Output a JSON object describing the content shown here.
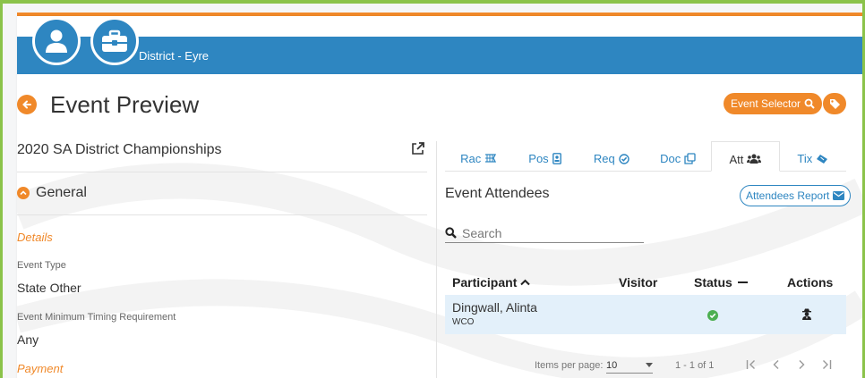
{
  "header": {
    "district": "District - Eyre"
  },
  "page": {
    "title": "Event Preview"
  },
  "actions": {
    "event_selector": "Event Selector"
  },
  "event": {
    "name": "2020 SA District Championships",
    "section": "General",
    "details_heading": "Details",
    "fields": [
      {
        "label": "Event Type",
        "value": "State Other"
      },
      {
        "label": "Event Minimum Timing Requirement",
        "value": "Any"
      }
    ],
    "payment_heading": "Payment"
  },
  "tabs": [
    {
      "label": "Rac",
      "icon": "checkered-flag-icon"
    },
    {
      "label": "Pos",
      "icon": "id-badge-icon"
    },
    {
      "label": "Req",
      "icon": "check-circle-icon"
    },
    {
      "label": "Doc",
      "icon": "copy-docs-icon"
    },
    {
      "label": "Att",
      "icon": "users-icon",
      "active": true
    },
    {
      "label": "Tix",
      "icon": "ticket-icon"
    }
  ],
  "attendees": {
    "title": "Event Attendees",
    "report_button": "Attendees Report",
    "search_placeholder": "Search",
    "columns": [
      "Participant",
      "Visitor",
      "Status",
      "Actions"
    ],
    "rows": [
      {
        "name": "Dingwall, Alinta",
        "sub": "WCO",
        "visitor": "",
        "status": "check-circle-icon",
        "action": "user-secret-icon"
      }
    ],
    "paginator": {
      "items_per_page_label": "Items per page:",
      "items_per_page": "10",
      "range": "1 - 1 of 1"
    }
  },
  "colors": {
    "brand_blue": "#2e86c1",
    "accent_orange": "#f0892a",
    "frame_green": "#8bc34a",
    "row_highlight": "#e3f0fa",
    "status_green": "#4caf50"
  }
}
